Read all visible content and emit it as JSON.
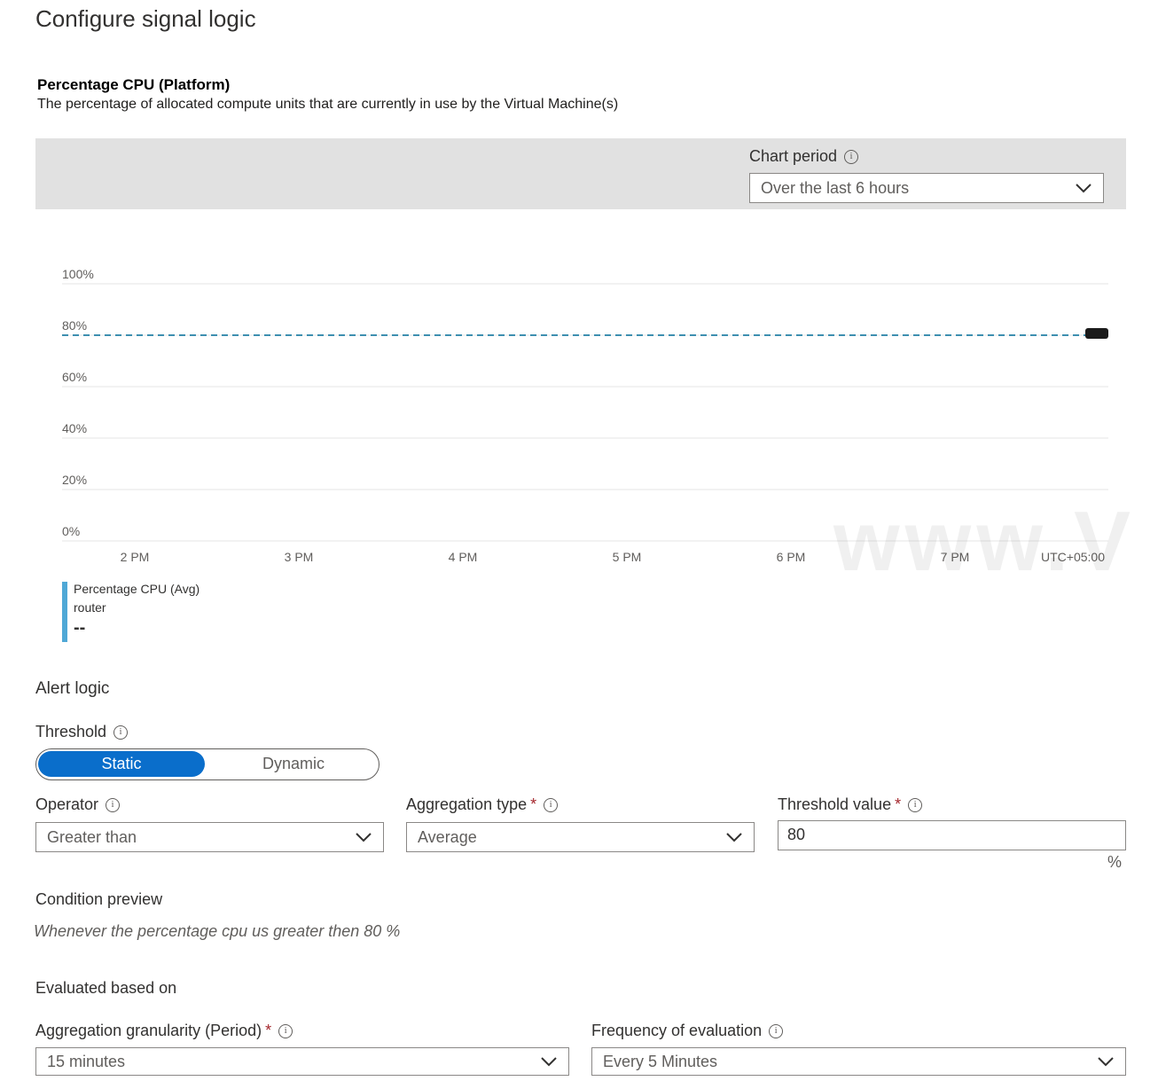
{
  "page": {
    "title": "Configure signal logic"
  },
  "metric": {
    "name": "Percentage CPU (Platform)",
    "description": "The percentage of allocated compute units that are currently in use by the Virtual Machine(s)"
  },
  "chart_period": {
    "label": "Chart period",
    "value": "Over the last 6 hours"
  },
  "chart_data": {
    "type": "line",
    "y_ticks": [
      "100%",
      "80%",
      "60%",
      "40%",
      "20%",
      "0%"
    ],
    "x_ticks": [
      "2 PM",
      "3 PM",
      "4 PM",
      "5 PM",
      "6 PM",
      "7 PM",
      "UTC+05:00"
    ],
    "ylim": [
      0,
      100
    ],
    "threshold": 80,
    "series": [
      {
        "values": []
      }
    ],
    "legend": {
      "metric": "Percentage CPU (Avg)",
      "resource": "router",
      "value": "--"
    },
    "colors": {
      "threshold_line": "#3e8fb0",
      "legend_bar": "#4fa8d6"
    }
  },
  "alert_logic": {
    "heading": "Alert logic",
    "threshold_label": "Threshold",
    "threshold_options": [
      "Static",
      "Dynamic"
    ],
    "threshold_selected": "Static",
    "operator": {
      "label": "Operator",
      "value": "Greater than"
    },
    "aggregation_type": {
      "label": "Aggregation type",
      "value": "Average"
    },
    "threshold_value": {
      "label": "Threshold value",
      "value": "80",
      "unit": "%"
    }
  },
  "condition_preview": {
    "heading": "Condition preview",
    "text": "Whenever the percentage cpu us greater then 80 %"
  },
  "evaluated": {
    "heading": "Evaluated based on",
    "granularity": {
      "label": "Aggregation granularity (Period)",
      "value": "15 minutes"
    },
    "frequency": {
      "label": "Frequency of evaluation",
      "value": "Every 5 Minutes"
    }
  },
  "watermark": {
    "text": "www.V"
  },
  "colors": {
    "accent": "#0a6ecb",
    "required": "#a4262c"
  }
}
